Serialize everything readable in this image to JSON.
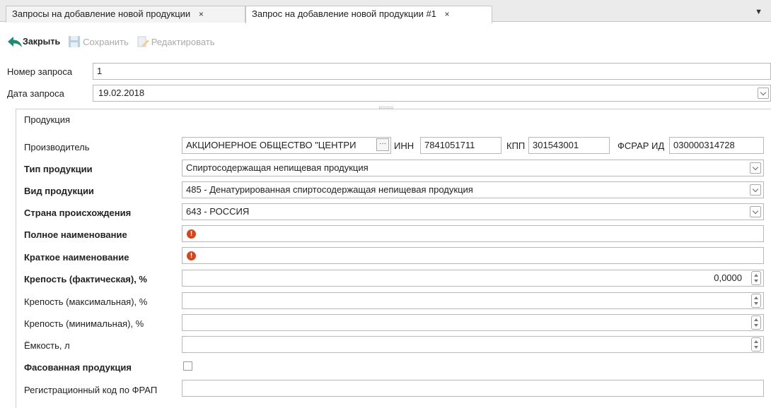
{
  "tabs": [
    {
      "label": "Запросы на добавление новой продукции",
      "close": "×"
    },
    {
      "label": "Запрос на добавление новой продукции #1",
      "close": "×"
    }
  ],
  "tab_menu": "▼",
  "toolbar": {
    "close_label": "Закрыть",
    "save_label": "Сохранить",
    "edit_label": "Редактировать"
  },
  "header": {
    "request_number_label": "Номер запроса",
    "request_number_value": "1",
    "request_date_label": "Дата запроса",
    "request_date_value": "19.02.2018"
  },
  "product": {
    "section_title": "Продукция",
    "manufacturer_label": "Производитель",
    "manufacturer_value": "АКЦИОНЕРНОЕ ОБЩЕСТВО \"ЦЕНТРИ",
    "ellipsis": "···",
    "inn_label": "ИНН",
    "inn_value": "7841051711",
    "kpp_label": "КПП",
    "kpp_value": "301543001",
    "fsrar_label": "ФСРАР ИД",
    "fsrar_value": "030000314728",
    "type_label": "Тип продукции",
    "type_value": "Спиртосодержащая непищевая продукция",
    "kind_label": "Вид продукции",
    "kind_value": "485 - Денатурированная спиртосодержащая непищевая продукция",
    "country_label": "Страна происхождения",
    "country_value": "643 - РОССИЯ",
    "full_name_label": "Полное наименование",
    "full_name_value": "",
    "short_name_label": "Краткое наименование",
    "short_name_value": "",
    "error_glyph": "!",
    "strength_actual_label": "Крепость (фактическая), %",
    "strength_actual_value": "0,0000",
    "strength_max_label": "Крепость (максимальная), %",
    "strength_max_value": "",
    "strength_min_label": "Крепость (минимальная), %",
    "strength_min_value": "",
    "capacity_label": "Ёмкость, л",
    "capacity_value": "",
    "packaged_label": "Фасованная продукция",
    "packaged_checked": false,
    "reg_code_label": "Регистрационный код по ФРАП",
    "reg_code_value": ""
  },
  "colors": {
    "accent": "#1f8a73",
    "error": "#d9451b",
    "border": "#b8b8b8"
  }
}
